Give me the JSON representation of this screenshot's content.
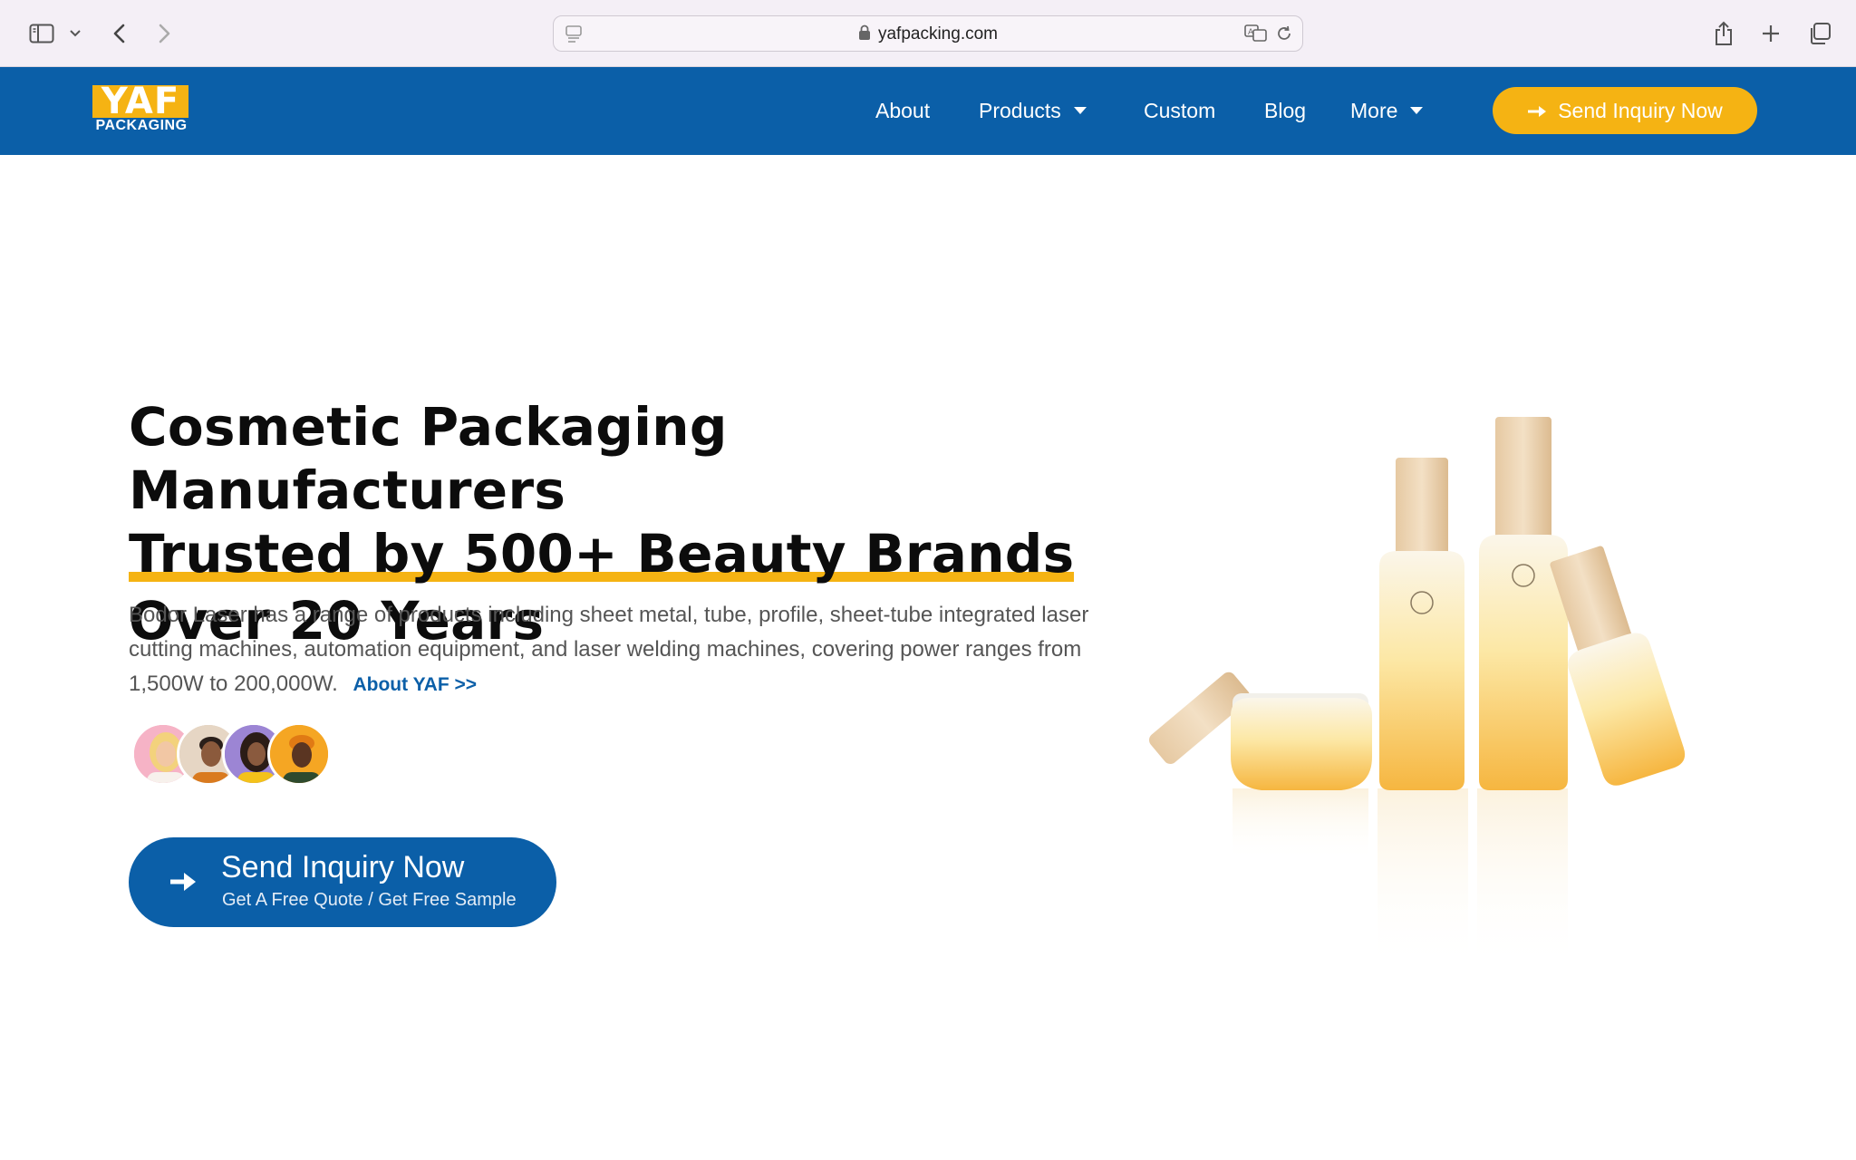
{
  "browser": {
    "url": "yafpacking.com"
  },
  "site": {
    "logo": {
      "top": "YAF",
      "bottom": "PACKAGING"
    },
    "nav": [
      {
        "label": "About",
        "dropdown": false
      },
      {
        "label": "Products",
        "dropdown": true
      },
      {
        "label": "Custom",
        "dropdown": false
      },
      {
        "label": "Blog",
        "dropdown": false
      },
      {
        "label": "More",
        "dropdown": true
      }
    ],
    "nav_cta": "Send Inquiry Now"
  },
  "hero": {
    "headline_line1": "Cosmetic Packaging Manufacturers",
    "headline_line2": "Trusted by 500+ Beauty Brands",
    "headline_line3": "Over 20 Years",
    "description": "Bodor Laser has a range of products including sheet metal, tube, profile, sheet-tube integrated laser cutting machines, automation equipment, and laser welding machines, covering power ranges from 1,500W to 200,000W.",
    "about_link": "About YAF >>",
    "cta_main": "Send Inquiry Now",
    "cta_sub": "Get A Free Quote / Get Free Sample"
  },
  "colors": {
    "brand_blue": "#0b5fa8",
    "accent_yellow": "#f5b313"
  }
}
